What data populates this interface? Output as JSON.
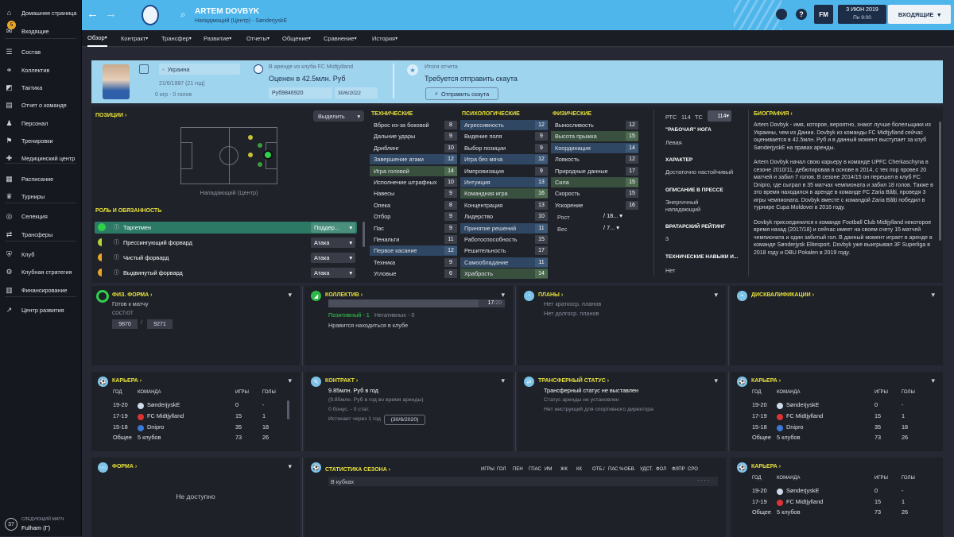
{
  "sidebar": {
    "items": [
      {
        "label": "Домашняя страница",
        "icon": "home-icon"
      },
      {
        "label": "Входящие",
        "icon": "inbox-icon",
        "badge": "5"
      },
      {
        "label": "Состав",
        "icon": "squad-icon"
      },
      {
        "label": "Коллектив",
        "icon": "dynamics-icon"
      },
      {
        "label": "Тактика",
        "icon": "tactics-icon"
      },
      {
        "label": "Отчет о команде",
        "icon": "report-icon"
      },
      {
        "label": "Персонал",
        "icon": "staff-icon"
      },
      {
        "label": "Тренировки",
        "icon": "training-icon"
      },
      {
        "label": "Медицинский центр",
        "icon": "medical-icon"
      },
      {
        "label": "Расписание",
        "icon": "calendar-icon"
      },
      {
        "label": "Турниры",
        "icon": "trophy-icon"
      },
      {
        "label": "Селекция",
        "icon": "scouting-icon"
      },
      {
        "label": "Трансферы",
        "icon": "transfers-icon"
      },
      {
        "label": "Клуб",
        "icon": "club-icon"
      },
      {
        "label": "Клубная стратегия",
        "icon": "strategy-icon"
      },
      {
        "label": "Финансирование",
        "icon": "finance-icon"
      },
      {
        "label": "Центр развития",
        "icon": "development-icon"
      }
    ],
    "next_match": {
      "label": "СЛЕДУЮЩИЙ МАТЧ",
      "opponent": "Fulham (Г)",
      "days": "37"
    }
  },
  "header": {
    "player_name": "ARTEM DOVBYK",
    "subtitle": "Нападающий (Центр) - SønderjyskE",
    "date": "3 ИЮН 2019",
    "time": "Пн 9:00",
    "continue_label": "ВХОДЯЩИЕ",
    "fm_label": "FM",
    "help_label": "?"
  },
  "tabs": [
    "Обзор",
    "Контракт",
    "Трансфер",
    "Развитие",
    "Отчеты",
    "Общение",
    "Сравнение",
    "История"
  ],
  "profile": {
    "nationality": "Украина",
    "birth": "21/6/1997 (21 год)",
    "caps": "0 игр - 0 голов",
    "loan": "В аренде из клуба FC Midtjylland",
    "value": "Оценен в 42.5млн. Руб",
    "wage": "Руб9846920",
    "contract_end": "30/6/2022",
    "report_title": "Итоги отчета",
    "report_text": "Требуется отправить скаута",
    "scout_button": "Отправить скаута"
  },
  "positions": {
    "title": "ПОЗИЦИИ",
    "select_label": "Выделить",
    "position_name": "Нападающий (Центр)"
  },
  "roles": {
    "title": "РОЛЬ И ОБЯЗАННОСТЬ",
    "items": [
      {
        "name": "Таргетмен",
        "duty": "Поддер...",
        "color": "#2fd04a"
      },
      {
        "name": "Прессингующий форвард",
        "duty": "Атака",
        "color": "#b8d43a"
      },
      {
        "name": "Чистый форвард",
        "duty": "Атака",
        "color": "#e8a62a"
      },
      {
        "name": "Выдвинутый форвард",
        "duty": "Атака",
        "color": "#e8a62a"
      }
    ]
  },
  "attributes": {
    "technical_title": "ТЕХНИЧЕСКИЕ",
    "mental_title": "ПСИХОЛОГИЧЕСКИЕ",
    "physical_title": "ФИЗИЧЕСКИЕ",
    "technical": [
      {
        "n": "Вброс из-за боковой",
        "v": "8",
        "h": ""
      },
      {
        "n": "Дальние удары",
        "v": "9",
        "h": ""
      },
      {
        "n": "Дриблинг",
        "v": "10",
        "h": ""
      },
      {
        "n": "Завершение атаки",
        "v": "12",
        "h": "blue"
      },
      {
        "n": "Игра головой",
        "v": "14",
        "h": "green"
      },
      {
        "n": "Исполнение штрафных",
        "v": "10",
        "h": ""
      },
      {
        "n": "Навесы",
        "v": "9",
        "h": ""
      },
      {
        "n": "Опека",
        "v": "8",
        "h": ""
      },
      {
        "n": "Отбор",
        "v": "9",
        "h": ""
      },
      {
        "n": "Пас",
        "v": "9",
        "h": ""
      },
      {
        "n": "Пенальти",
        "v": "11",
        "h": ""
      },
      {
        "n": "Первое касание",
        "v": "12",
        "h": "blue"
      },
      {
        "n": "Техника",
        "v": "9",
        "h": ""
      },
      {
        "n": "Угловые",
        "v": "6",
        "h": ""
      }
    ],
    "mental": [
      {
        "n": "Агрессивность",
        "v": "12",
        "h": "blue"
      },
      {
        "n": "Видение поля",
        "v": "9",
        "h": ""
      },
      {
        "n": "Выбор позиции",
        "v": "9",
        "h": ""
      },
      {
        "n": "Игра без мяча",
        "v": "12",
        "h": "blue"
      },
      {
        "n": "Импровизация",
        "v": "9",
        "h": ""
      },
      {
        "n": "Интуиция",
        "v": "13",
        "h": "blue"
      },
      {
        "n": "Командная игра",
        "v": "16",
        "h": "green"
      },
      {
        "n": "Концентрация",
        "v": "13",
        "h": ""
      },
      {
        "n": "Лидерство",
        "v": "10",
        "h": ""
      },
      {
        "n": "Принятие решений",
        "v": "11",
        "h": "blue"
      },
      {
        "n": "Работоспособность",
        "v": "15",
        "h": ""
      },
      {
        "n": "Решительность",
        "v": "17",
        "h": ""
      },
      {
        "n": "Самообладание",
        "v": "11",
        "h": "blue"
      },
      {
        "n": "Храбрость",
        "v": "14",
        "h": "green"
      }
    ],
    "physical": [
      {
        "n": "Выносливость",
        "v": "12",
        "h": ""
      },
      {
        "n": "Высота прыжка",
        "v": "15",
        "h": "green"
      },
      {
        "n": "Координация",
        "v": "14",
        "h": "blue"
      },
      {
        "n": "Ловкость",
        "v": "12",
        "h": ""
      },
      {
        "n": "Природные данные",
        "v": "17",
        "h": ""
      },
      {
        "n": "Сила",
        "v": "15",
        "h": "green"
      },
      {
        "n": "Скорость",
        "v": "15",
        "h": ""
      },
      {
        "n": "Ускорение",
        "v": "16",
        "h": ""
      }
    ],
    "height_label": "Рост",
    "height_value": "18...",
    "weight_label": "Вес",
    "weight_value": "7..."
  },
  "details": {
    "ptc_label": "РТС",
    "ptc_value": "114",
    "tc_label": "ТС",
    "tc_value": "114",
    "foot_title": "\"РАБОЧАЯ\" НОГА",
    "foot_value": "Левая",
    "char_title": "ХАРАКТЕР",
    "char_value": "Достаточно настойчивый",
    "press_title": "ОПИСАНИЕ В ПРЕССЕ",
    "press_value": "Энергичный нападающий",
    "rating_title": "ВРАТАРСКИЙ РЕЙТИНГ",
    "rating_value": "3",
    "skills_title": "ТЕХНИЧЕСКИЕ НАВЫКИ И...",
    "skills_value": "Нет"
  },
  "bio": {
    "title": "БИОГРАФИЯ",
    "p1": "Artem Dovbyk - имя, которое, вероятно, знают лучше болельщики из Украины, чем из Дании. Dovbyk из команды FC Midtjylland сейчас оценивается в 42.5млн. Руб и в данный момент выступает за клуб SønderjyskE на правах аренды.",
    "p2": "Artem Dovbyk начал свою карьеру в команде UPFC Cherkaschyna в сезоне 2010/11, дебютировав в основе в 2014, с тех пор провел 20 матчей и забил 7 голов. В сезоне 2014/15 он перешел в клуб FC Dnipro, где сыграл в 35 матчах чемпионата и забил 18 голов. Также в это время находился в аренде в команде FC Zaria Bălți, проведя 3 игры чемпионата. Dovbyk вместе с командой Zaria Bălți победил в турнире Cupa Moldovei в 2016 году.",
    "p3": "Dovbyk присоединился к команде Football Club Midtjylland некоторое время назад (2017/18) и сейчас имеет на своем счету 15 матчей чемпионата и один забитый гол. В данный момент играет в аренде в команде Sønderjysk Elitesport. Dovbyk уже выигрывал 3F Superliga в 2018 году и DBU Pokalen в 2019 году."
  },
  "fitness": {
    "title": "ФИЗ. ФОРМА",
    "status": "Готов к матчу",
    "cond_label": "СОСТ/ОТ",
    "cond": "9870",
    "sharp": "9271"
  },
  "dynamics": {
    "title": "КОЛЛЕКТИВ",
    "bar_value": "17",
    "bar_max": "/20",
    "positive": "Позитивный - 1",
    "negative": "Негативных - 0",
    "note": "Нравится находиться в клубе",
    "bar_fraction": 0.85
  },
  "plans": {
    "title": "ПЛАНЫ",
    "short": "Нет краткоср. планов",
    "long": "Нет долгоср. планов"
  },
  "discipline": {
    "title": "ДИСКВАЛИФИКАЦИИ"
  },
  "career1": {
    "title": "КАРЬЕРА",
    "h_year": "ГОД",
    "h_team": "КОМАНДА",
    "h_apps": "ИГРЫ",
    "h_goals": "ГОЛЫ",
    "rows": [
      {
        "y": "19-20",
        "t": "SønderjyskE",
        "a": "0",
        "g": "-",
        "c": ""
      },
      {
        "y": "17-19",
        "t": "FC Midtjylland",
        "a": "15",
        "g": "1",
        "c": "red"
      },
      {
        "y": "15-18",
        "t": "Dnipro",
        "a": "35",
        "g": "18",
        "c": "blue"
      }
    ],
    "total_label": "Общее",
    "total_clubs": "5 клубов",
    "total_apps": "73",
    "total_goals": "26"
  },
  "contract": {
    "title": "КОНТРАКТ",
    "wage": "9.85млн. Руб в год",
    "loan_wage": "(9.85млн. Руб в год во время аренды)",
    "bonus": "0 бонус. - 0 стат.",
    "expires": "Истекает через 1 год",
    "expires_date": "(30/6/2020)"
  },
  "transfer": {
    "title": "ТРАНСФЕРНЫЙ СТАТУС",
    "status": "Трансферный статус не выставлен",
    "loan": "Статус аренды не установлен",
    "instr": "Нет инструкций для спортивного директора"
  },
  "career2": {
    "title": "КАРЬЕРА",
    "rows": [
      {
        "y": "19-20",
        "t": "SønderjyskE",
        "a": "0",
        "g": "-",
        "c": ""
      },
      {
        "y": "17-19",
        "t": "FC Midtjylland",
        "a": "15",
        "g": "1",
        "c": "red"
      },
      {
        "y": "15-18",
        "t": "Dnipro",
        "a": "35",
        "g": "18",
        "c": "blue"
      }
    ],
    "total_label": "Общее",
    "total_clubs": "5 клубов",
    "total_apps": "73",
    "total_goals": "26"
  },
  "form": {
    "title": "ФОРМА",
    "na": "Не доступно"
  },
  "season": {
    "title": "СТАТИСТИКА СЕЗОНА",
    "row_label": "В кубках",
    "cols": [
      "ИГРЫ",
      "ГОЛ",
      "ПЕН",
      "ГПАС",
      "ИМ",
      "ЖК",
      "КК",
      "ОТБ./",
      "ПАС %",
      "ОБВ.",
      "УДСТ.",
      "ФОЛ",
      "ФЛПР",
      "СРО"
    ]
  },
  "career3": {
    "title": "КАРЬЕРА",
    "h_year": "ГОД",
    "h_team": "КОМАНДА",
    "h_apps": "ИГРЫ",
    "h_goals": "ГОЛЫ",
    "rows": [
      {
        "y": "19-20",
        "t": "SønderjyskE",
        "a": "0",
        "g": "-",
        "c": ""
      },
      {
        "y": "17-19",
        "t": "FC Midtjylland",
        "a": "15",
        "g": "1",
        "c": "red"
      }
    ],
    "total_label": "Общее",
    "total_clubs": "5 клубов",
    "total_apps": "73",
    "total_goals": "26"
  },
  "colors": {
    "header": "#4fb6ec",
    "accent": "#e9e23a",
    "panel": "#1f2229",
    "highlight_blue": "#2f4762",
    "highlight_green": "#39503e"
  }
}
